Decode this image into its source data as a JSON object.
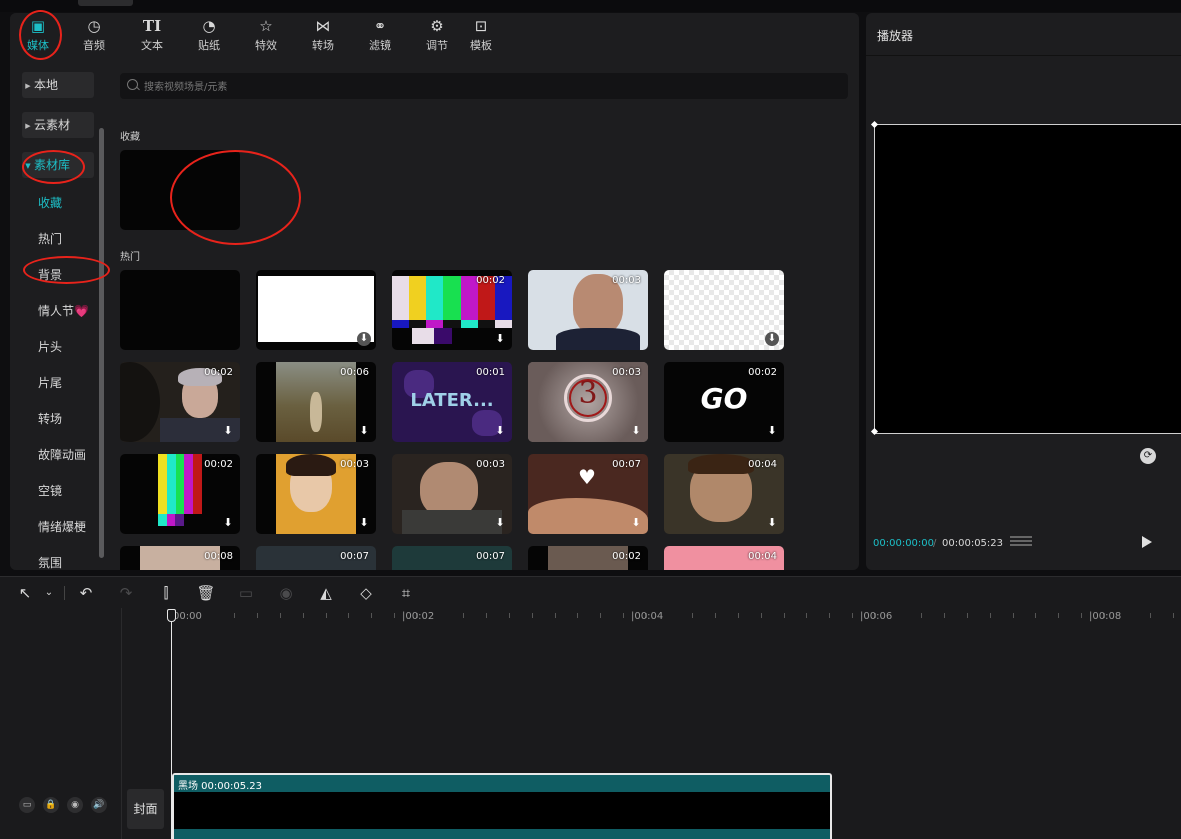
{
  "categories": [
    {
      "label": "媒体",
      "icon": "media-icon"
    },
    {
      "label": "音频",
      "icon": "audio-icon"
    },
    {
      "label": "文本",
      "icon": "text-icon"
    },
    {
      "label": "贴纸",
      "icon": "sticker-icon"
    },
    {
      "label": "特效",
      "icon": "effects-icon"
    },
    {
      "label": "转场",
      "icon": "transition-icon"
    },
    {
      "label": "滤镜",
      "icon": "filter-icon"
    },
    {
      "label": "调节",
      "icon": "adjust-icon"
    },
    {
      "label": "模板",
      "icon": "template-icon"
    }
  ],
  "sidebar": {
    "headers": [
      {
        "label": "本地"
      },
      {
        "label": "云素材"
      },
      {
        "label": "素材库"
      }
    ],
    "items": [
      {
        "label": "收藏"
      },
      {
        "label": "热门"
      },
      {
        "label": "背景"
      },
      {
        "label": "情人节💗"
      },
      {
        "label": "片头"
      },
      {
        "label": "片尾"
      },
      {
        "label": "转场"
      },
      {
        "label": "故障动画"
      },
      {
        "label": "空镜"
      },
      {
        "label": "情绪爆梗"
      },
      {
        "label": "氛围"
      }
    ]
  },
  "search": {
    "placeholder": "搜索视频场景/元素"
  },
  "sections": {
    "favorites": "收藏",
    "hot": "热门"
  },
  "grid": {
    "row1": [
      "",
      "",
      "00:02",
      "00:03",
      ""
    ],
    "row2": [
      "00:02",
      "00:06",
      "00:01",
      "00:03",
      "00:02"
    ],
    "row3": [
      "00:02",
      "00:03",
      "00:03",
      "00:07",
      "00:04"
    ],
    "row4": [
      "00:08",
      "00:07",
      "00:07",
      "00:02",
      "00:04"
    ],
    "later_text": "LATER...",
    "go_text": "GO",
    "countdown_text": "3"
  },
  "player": {
    "title": "播放器",
    "time_current": "00:00:00:00",
    "time_separator": "/",
    "time_total": "00:00:05:23"
  },
  "timeline": {
    "ruler": [
      "00:00",
      "|00:02",
      "|00:04",
      "|00:06",
      "|00:08"
    ],
    "clip_label": "黑场  00:00:05.23",
    "cover": "封面"
  },
  "colors": {
    "accent": "#1dbfc7",
    "annotation": "#e8231b",
    "clip": "#0f5d63"
  }
}
